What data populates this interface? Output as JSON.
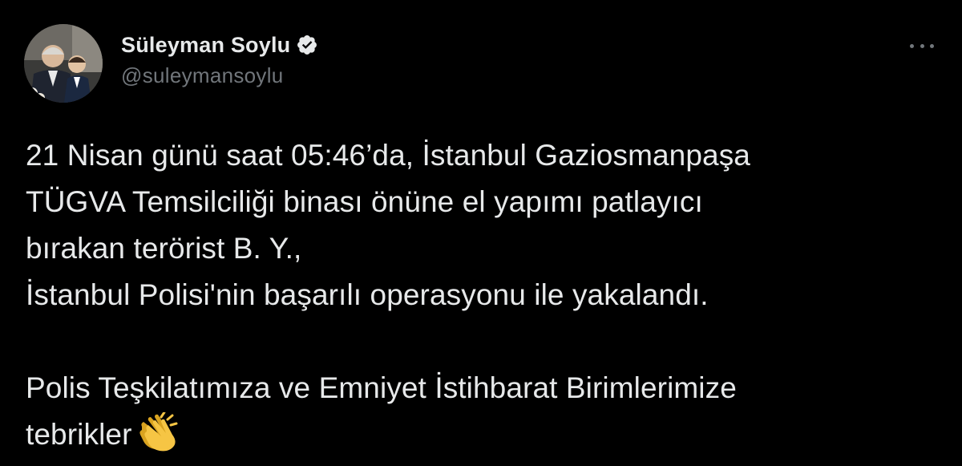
{
  "author": {
    "display_name": "Süleyman Soylu",
    "handle": "@suleymansoylu",
    "verified_icon": "verified-badge-icon",
    "avatar": "profile-photo"
  },
  "menu": {
    "icon": "more-options-icon"
  },
  "tweet": {
    "lines": [
      "21 Nisan günü saat 05:46’da, İstanbul Gaziosmanpaşa",
      "TÜGVA Temsilciliği binası önüne el yapımı patlayıcı",
      "bırakan terörist B. Y.,",
      "İstanbul Polisi'nin başarılı operasyonu ile yakalandı."
    ],
    "lines2": [
      "Polis Teşkilatımıza ve Emniyet İstihbarat Birimlerimize",
      "tebrikler"
    ],
    "emoji": "clapping-hands-icon"
  },
  "colors": {
    "background": "#000000",
    "text": "#e7e9ea",
    "secondary": "#71767b",
    "emoji": "#f6c544"
  }
}
